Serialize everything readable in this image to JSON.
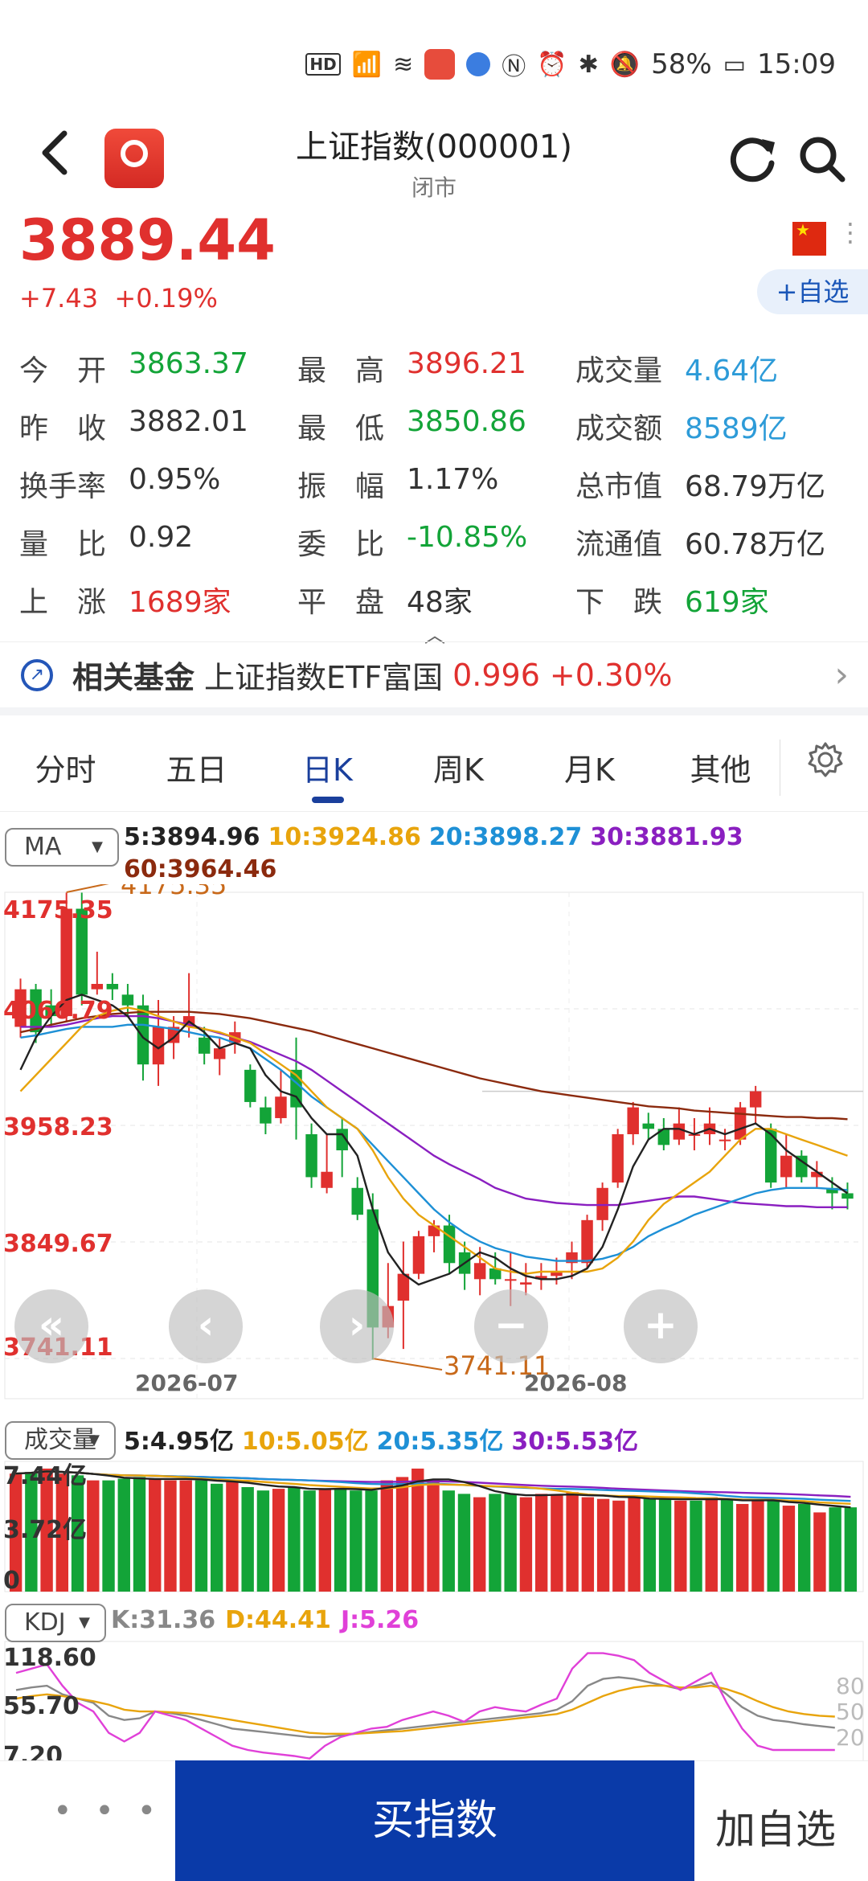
{
  "status_bar": {
    "battery": "58%",
    "time": "15:09",
    "signal": "4G",
    "hd": "HD"
  },
  "header": {
    "back_icon": "chevron-left-icon",
    "title": "上证指数(000001)",
    "subtitle": "闭市"
  },
  "quote": {
    "price": "3889.44",
    "change": "+7.43",
    "change_pct": "+0.19%",
    "watch_button": "+自选"
  },
  "stats": [
    [
      {
        "label": "今　开",
        "value": "3863.37",
        "color": "green"
      },
      {
        "label": "最　高",
        "value": "3896.21",
        "color": "red"
      },
      {
        "label": "成交量",
        "value": "4.64亿",
        "color": "blue"
      }
    ],
    [
      {
        "label": "昨　收",
        "value": "3882.01",
        "color": "normal"
      },
      {
        "label": "最　低",
        "value": "3850.86",
        "color": "green"
      },
      {
        "label": "成交额",
        "value": "8589亿",
        "color": "blue"
      }
    ],
    [
      {
        "label": "换手率",
        "value": "0.95%",
        "color": "normal"
      },
      {
        "label": "振　幅",
        "value": "1.17%",
        "color": "normal"
      },
      {
        "label": "总市值",
        "value": "68.79万亿",
        "color": "normal"
      }
    ],
    [
      {
        "label": "量　比",
        "value": "0.92",
        "color": "normal"
      },
      {
        "label": "委　比",
        "value": "-10.85%",
        "color": "green"
      },
      {
        "label": "流通值",
        "value": "60.78万亿",
        "color": "normal"
      }
    ],
    [
      {
        "label": "上　涨",
        "value": "1689家",
        "color": "red"
      },
      {
        "label": "平　盘",
        "value": "48家",
        "color": "normal"
      },
      {
        "label": "下　跌",
        "value": "619家",
        "color": "green"
      }
    ]
  ],
  "fund": {
    "title": "相关基金",
    "name": "上证指数ETF富国",
    "price": "0.996",
    "change": "+0.30%"
  },
  "tabs": [
    "分时",
    "五日",
    "日K",
    "周K",
    "月K",
    "其他"
  ],
  "active_tab": "日K",
  "ma": {
    "select": "MA",
    "items": [
      {
        "text": "5:3894.96",
        "color": "#222222"
      },
      {
        "text": "10:3924.86",
        "color": "#e8a40c"
      },
      {
        "text": "20:3898.27",
        "color": "#1e90d6"
      },
      {
        "text": "30:3881.93",
        "color": "#8a1fc0"
      },
      {
        "text": "60:3964.46",
        "color": "#8b2a0e"
      }
    ]
  },
  "volume": {
    "select": "成交量",
    "items": [
      {
        "text": "5:4.95亿",
        "color": "#222222"
      },
      {
        "text": "10:5.05亿",
        "color": "#e8a40c"
      },
      {
        "text": "20:5.35亿",
        "color": "#1e90d6"
      },
      {
        "text": "30:5.53亿",
        "color": "#8a1fc0"
      }
    ]
  },
  "kdj": {
    "select": "KDJ",
    "items": [
      {
        "text": "K:31.36",
        "color": "#888888"
      },
      {
        "text": "D:44.41",
        "color": "#e8a40c"
      },
      {
        "text": "J:5.26",
        "color": "#e040d8"
      }
    ]
  },
  "bottom": {
    "more": "• • •",
    "buy": "买指数",
    "add": "加自选"
  },
  "chart_data": [
    {
      "type": "candlestick",
      "title": "",
      "y_labels": [
        "4175.35",
        "4066.79",
        "3958.23",
        "3849.67",
        "3741.11"
      ],
      "ylim": [
        3741.11,
        4175.35
      ],
      "x_labels": [
        "2026-07",
        "2026-08"
      ],
      "max_marker": "4175.35",
      "min_marker": "3741.11",
      "candles": [
        {
          "o": 4050,
          "c": 4085,
          "h": 4095,
          "l": 4040
        },
        {
          "o": 4085,
          "c": 4045,
          "h": 4090,
          "l": 4035
        },
        {
          "o": 4070,
          "c": 4060,
          "h": 4085,
          "l": 4050
        },
        {
          "o": 4060,
          "c": 4160,
          "h": 4175,
          "l": 4055
        },
        {
          "o": 4160,
          "c": 4080,
          "h": 4175,
          "l": 4070
        },
        {
          "o": 4085,
          "c": 4090,
          "h": 4120,
          "l": 4080
        },
        {
          "o": 4090,
          "c": 4085,
          "h": 4100,
          "l": 4075
        },
        {
          "o": 4080,
          "c": 4070,
          "h": 4090,
          "l": 4060
        },
        {
          "o": 4070,
          "c": 4015,
          "h": 4080,
          "l": 4000
        },
        {
          "o": 4015,
          "c": 4050,
          "h": 4075,
          "l": 3995
        },
        {
          "o": 4035,
          "c": 4050,
          "h": 4060,
          "l": 4020
        },
        {
          "o": 4050,
          "c": 4060,
          "h": 4100,
          "l": 4040
        },
        {
          "o": 4040,
          "c": 4025,
          "h": 4050,
          "l": 4015
        },
        {
          "o": 4020,
          "c": 4030,
          "h": 4040,
          "l": 4005
        },
        {
          "o": 4035,
          "c": 4045,
          "h": 4055,
          "l": 4025
        },
        {
          "o": 4010,
          "c": 3980,
          "h": 4015,
          "l": 3975
        },
        {
          "o": 3975,
          "c": 3960,
          "h": 3985,
          "l": 3950
        },
        {
          "o": 3965,
          "c": 3985,
          "h": 4010,
          "l": 3960
        },
        {
          "o": 4010,
          "c": 3975,
          "h": 4040,
          "l": 3945
        },
        {
          "o": 3950,
          "c": 3910,
          "h": 3960,
          "l": 3900
        },
        {
          "o": 3900,
          "c": 3915,
          "h": 3950,
          "l": 3895
        },
        {
          "o": 3955,
          "c": 3935,
          "h": 3965,
          "l": 3910
        },
        {
          "o": 3900,
          "c": 3875,
          "h": 3910,
          "l": 3870
        },
        {
          "o": 3880,
          "c": 3770,
          "h": 3895,
          "l": 3740
        },
        {
          "o": 3770,
          "c": 3790,
          "h": 3830,
          "l": 3760
        },
        {
          "o": 3795,
          "c": 3820,
          "h": 3850,
          "l": 3750
        },
        {
          "o": 3820,
          "c": 3855,
          "h": 3860,
          "l": 3815
        },
        {
          "o": 3855,
          "c": 3865,
          "h": 3870,
          "l": 3840
        },
        {
          "o": 3865,
          "c": 3830,
          "h": 3875,
          "l": 3820
        },
        {
          "o": 3840,
          "c": 3820,
          "h": 3850,
          "l": 3805
        },
        {
          "o": 3815,
          "c": 3830,
          "h": 3845,
          "l": 3800
        },
        {
          "o": 3825,
          "c": 3815,
          "h": 3840,
          "l": 3810
        },
        {
          "o": 3815,
          "c": 3815,
          "h": 3840,
          "l": 3790
        },
        {
          "o": 3810,
          "c": 3812,
          "h": 3830,
          "l": 3800
        },
        {
          "o": 3815,
          "c": 3818,
          "h": 3830,
          "l": 3805
        },
        {
          "o": 3818,
          "c": 3822,
          "h": 3835,
          "l": 3810
        },
        {
          "o": 3830,
          "c": 3840,
          "h": 3850,
          "l": 3815
        },
        {
          "o": 3830,
          "c": 3870,
          "h": 3875,
          "l": 3825
        },
        {
          "o": 3870,
          "c": 3900,
          "h": 3905,
          "l": 3860
        },
        {
          "o": 3905,
          "c": 3950,
          "h": 3955,
          "l": 3900
        },
        {
          "o": 3950,
          "c": 3975,
          "h": 3980,
          "l": 3940
        },
        {
          "o": 3960,
          "c": 3955,
          "h": 3970,
          "l": 3945
        },
        {
          "o": 3955,
          "c": 3940,
          "h": 3965,
          "l": 3935
        },
        {
          "o": 3945,
          "c": 3960,
          "h": 3975,
          "l": 3940
        },
        {
          "o": 3950,
          "c": 3950,
          "h": 3965,
          "l": 3935
        },
        {
          "o": 3950,
          "c": 3960,
          "h": 3975,
          "l": 3940
        },
        {
          "o": 3945,
          "c": 3945,
          "h": 3955,
          "l": 3935
        },
        {
          "o": 3945,
          "c": 3975,
          "h": 3980,
          "l": 3940
        },
        {
          "o": 3975,
          "c": 3990,
          "h": 3995,
          "l": 3960
        },
        {
          "o": 3955,
          "c": 3905,
          "h": 3960,
          "l": 3900
        },
        {
          "o": 3910,
          "c": 3930,
          "h": 3950,
          "l": 3900
        },
        {
          "o": 3930,
          "c": 3910,
          "h": 3935,
          "l": 3905
        },
        {
          "o": 3910,
          "c": 3915,
          "h": 3925,
          "l": 3900
        },
        {
          "o": 3900,
          "c": 3895,
          "h": 3910,
          "l": 3880
        },
        {
          "o": 3895,
          "c": 3890,
          "h": 3905,
          "l": 3880
        }
      ],
      "ma5": [
        4010,
        4040,
        4060,
        4075,
        4080,
        4075,
        4070,
        4060,
        4040,
        4030,
        4040,
        4055,
        4045,
        4030,
        4035,
        4030,
        4005,
        3990,
        3985,
        3965,
        3950,
        3950,
        3930,
        3880,
        3840,
        3820,
        3810,
        3815,
        3820,
        3830,
        3840,
        3835,
        3825,
        3818,
        3815,
        3815,
        3818,
        3825,
        3845,
        3880,
        3920,
        3945,
        3955,
        3955,
        3950,
        3955,
        3950,
        3955,
        3960,
        3950,
        3935,
        3925,
        3915,
        3905,
        3895
      ],
      "ma10": [
        3990,
        4005,
        4020,
        4035,
        4050,
        4060,
        4065,
        4068,
        4065,
        4060,
        4055,
        4050,
        4048,
        4045,
        4040,
        4035,
        4025,
        4015,
        4005,
        3990,
        3975,
        3965,
        3955,
        3935,
        3910,
        3890,
        3875,
        3865,
        3855,
        3845,
        3835,
        3825,
        3822,
        3820,
        3822,
        3822,
        3822,
        3822,
        3825,
        3835,
        3850,
        3870,
        3885,
        3895,
        3905,
        3915,
        3930,
        3945,
        3955,
        3955,
        3950,
        3945,
        3940,
        3935,
        3930
      ],
      "ma20": [
        4040,
        4042,
        4045,
        4048,
        4050,
        4050,
        4050,
        4052,
        4052,
        4050,
        4048,
        4045,
        4042,
        4040,
        4035,
        4030,
        4020,
        4010,
        3998,
        3985,
        3975,
        3965,
        3955,
        3940,
        3925,
        3910,
        3895,
        3880,
        3868,
        3858,
        3850,
        3844,
        3840,
        3836,
        3834,
        3832,
        3832,
        3832,
        3834,
        3838,
        3845,
        3855,
        3862,
        3868,
        3875,
        3880,
        3885,
        3890,
        3895,
        3898,
        3900,
        3900,
        3900,
        3899,
        3898
      ],
      "ma30": [
        4050,
        4050,
        4050,
        4052,
        4055,
        4058,
        4060,
        4060,
        4060,
        4058,
        4055,
        4052,
        4048,
        4044,
        4040,
        4036,
        4030,
        4024,
        4018,
        4010,
        4000,
        3990,
        3980,
        3970,
        3960,
        3950,
        3940,
        3930,
        3922,
        3915,
        3908,
        3900,
        3895,
        3890,
        3888,
        3886,
        3885,
        3884,
        3884,
        3884,
        3886,
        3888,
        3890,
        3892,
        3892,
        3890,
        3888,
        3886,
        3885,
        3884,
        3883,
        3883,
        3882,
        3882,
        3882
      ],
      "ma60": [
        4045,
        4048,
        4052,
        4055,
        4058,
        4060,
        4062,
        4063,
        4064,
        4064,
        4064,
        4064,
        4063,
        4062,
        4060,
        4058,
        4055,
        4052,
        4049,
        4046,
        4042,
        4038,
        4034,
        4030,
        4026,
        4022,
        4018,
        4014,
        4010,
        4006,
        4002,
        3999,
        3996,
        3993,
        3990,
        3988,
        3986,
        3984,
        3982,
        3980,
        3978,
        3976,
        3975,
        3974,
        3972,
        3971,
        3970,
        3969,
        3968,
        3967,
        3966,
        3966,
        3965,
        3965,
        3964
      ]
    },
    {
      "type": "bar",
      "title": "",
      "y_labels": [
        "7.44亿",
        "3.72亿",
        "0"
      ],
      "ylim": [
        0,
        7.44
      ],
      "values": [
        7.0,
        7.1,
        7.3,
        7.0,
        6.9,
        6.6,
        6.6,
        6.7,
        6.8,
        6.7,
        6.6,
        6.6,
        6.6,
        6.4,
        6.5,
        6.2,
        6.0,
        6.1,
        6.2,
        6.0,
        6.1,
        6.1,
        6.0,
        6.0,
        6.6,
        6.8,
        7.3,
        6.6,
        6.0,
        5.8,
        5.6,
        5.8,
        5.8,
        5.6,
        5.8,
        5.7,
        5.9,
        5.6,
        5.5,
        5.4,
        5.6,
        5.5,
        5.5,
        5.4,
        5.4,
        5.6,
        5.5,
        5.2,
        5.4,
        5.4,
        5.1,
        5.2,
        4.7,
        5.0,
        5.0
      ],
      "up": [
        true,
        false,
        true,
        true,
        false,
        true,
        false,
        false,
        false,
        true,
        true,
        true,
        false,
        false,
        true,
        false,
        false,
        true,
        false,
        false,
        true,
        false,
        false,
        false,
        true,
        true,
        true,
        true,
        false,
        false,
        true,
        false,
        false,
        true,
        true,
        true,
        true,
        true,
        true,
        true,
        true,
        false,
        false,
        true,
        false,
        true,
        false,
        true,
        true,
        false,
        true,
        false,
        true,
        false,
        false
      ]
    },
    {
      "type": "line",
      "title": "",
      "y_labels": [
        "118.60",
        "55.70",
        "7.20"
      ],
      "right_labels": [
        "80",
        "50",
        "20"
      ],
      "ylim": [
        -7.2,
        118.6
      ],
      "series": [
        {
          "name": "K",
          "values": [
            75,
            78,
            80,
            70,
            65,
            60,
            45,
            40,
            42,
            50,
            48,
            45,
            40,
            35,
            30,
            28,
            26,
            24,
            22,
            20,
            20,
            22,
            24,
            26,
            28,
            30,
            32,
            34,
            36,
            38,
            40,
            42,
            44,
            46,
            48,
            52,
            62,
            80,
            88,
            90,
            88,
            84,
            80,
            76,
            80,
            84,
            70,
            55,
            45,
            40,
            38,
            35,
            33,
            31
          ]
        },
        {
          "name": "D",
          "values": [
            65,
            68,
            70,
            68,
            65,
            62,
            58,
            52,
            50,
            50,
            49,
            48,
            46,
            43,
            40,
            37,
            34,
            31,
            28,
            25,
            24,
            24,
            24,
            25,
            26,
            27,
            29,
            31,
            33,
            35,
            37,
            39,
            41,
            43,
            45,
            47,
            52,
            60,
            68,
            74,
            78,
            80,
            80,
            78,
            78,
            80,
            76,
            70,
            62,
            55,
            50,
            47,
            45,
            44
          ]
        },
        {
          "name": "J",
          "values": [
            95,
            100,
            105,
            80,
            60,
            50,
            25,
            15,
            25,
            50,
            45,
            40,
            30,
            20,
            10,
            5,
            2,
            0,
            -2,
            -5,
            10,
            20,
            25,
            30,
            32,
            40,
            45,
            50,
            45,
            38,
            50,
            55,
            52,
            50,
            58,
            65,
            100,
            118,
            118,
            115,
            110,
            95,
            85,
            75,
            85,
            95,
            60,
            30,
            10,
            5,
            5,
            5,
            5,
            5
          ]
        }
      ]
    }
  ]
}
